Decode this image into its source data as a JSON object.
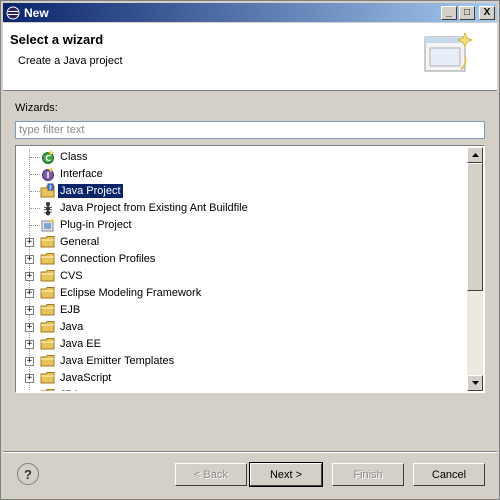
{
  "window": {
    "title": "New",
    "minimize": "_",
    "maximize": "□",
    "close": "X"
  },
  "header": {
    "title": "Select a wizard",
    "description": "Create a Java project"
  },
  "wizards": {
    "label": "Wizards:",
    "filter_placeholder": "type filter text",
    "filter_value": ""
  },
  "tree": {
    "items": [
      {
        "label": "Class",
        "icon": "class-icon",
        "expandable": false,
        "selected": false
      },
      {
        "label": "Interface",
        "icon": "interface-icon",
        "expandable": false,
        "selected": false
      },
      {
        "label": "Java Project",
        "icon": "java-project-icon",
        "expandable": false,
        "selected": true
      },
      {
        "label": "Java Project from Existing Ant Buildfile",
        "icon": "ant-icon",
        "expandable": false,
        "selected": false
      },
      {
        "label": "Plug-in Project",
        "icon": "plugin-icon",
        "expandable": false,
        "selected": false
      },
      {
        "label": "General",
        "icon": "folder-icon",
        "expandable": true,
        "selected": false
      },
      {
        "label": "Connection Profiles",
        "icon": "folder-icon",
        "expandable": true,
        "selected": false
      },
      {
        "label": "CVS",
        "icon": "folder-icon",
        "expandable": true,
        "selected": false
      },
      {
        "label": "Eclipse Modeling Framework",
        "icon": "folder-icon",
        "expandable": true,
        "selected": false
      },
      {
        "label": "EJB",
        "icon": "folder-icon",
        "expandable": true,
        "selected": false
      },
      {
        "label": "Java",
        "icon": "folder-icon",
        "expandable": true,
        "selected": false
      },
      {
        "label": "Java EE",
        "icon": "folder-icon",
        "expandable": true,
        "selected": false
      },
      {
        "label": "Java Emitter Templates",
        "icon": "folder-icon",
        "expandable": true,
        "selected": false
      },
      {
        "label": "JavaScript",
        "icon": "folder-icon",
        "expandable": true,
        "selected": false
      },
      {
        "label": "JPA",
        "icon": "folder-icon",
        "expandable": true,
        "selected": false
      }
    ]
  },
  "buttons": {
    "help": "?",
    "back": "< Back",
    "next": "Next >",
    "finish": "Finish",
    "cancel": "Cancel"
  },
  "colors": {
    "selection": "#0a246a",
    "titlebar": "#0a246a",
    "folder": "#e8c25a"
  }
}
